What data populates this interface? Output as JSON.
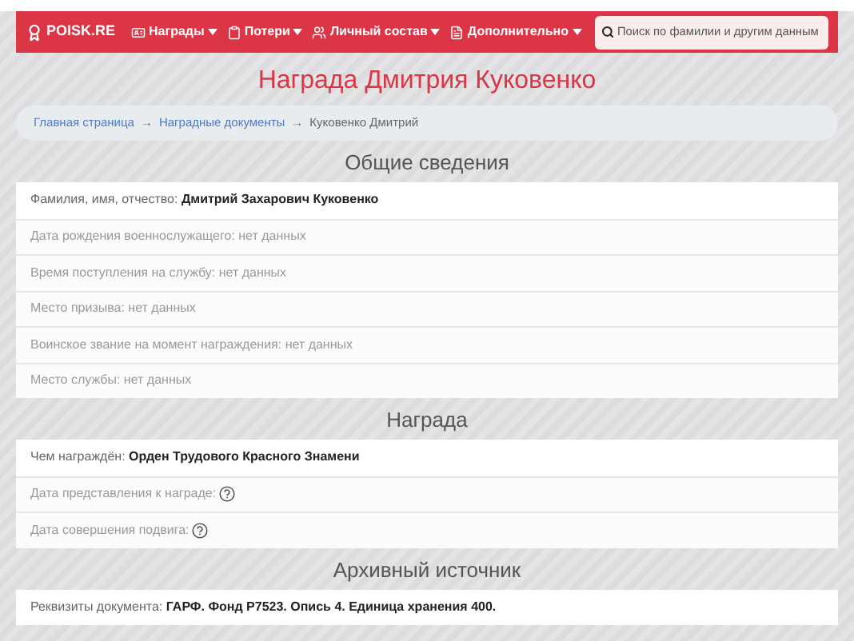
{
  "navbar": {
    "logo": "POISK.RE",
    "menus": [
      {
        "label": "Награды"
      },
      {
        "label": "Потери"
      },
      {
        "label": "Личный состав"
      },
      {
        "label": "Дополнительно"
      }
    ],
    "search": {
      "placeholder": "Поиск по фамилии и другим данным"
    }
  },
  "title": "Награда Дмитрия Куковенко",
  "breadcrumb": {
    "links": [
      "Главная страница",
      "Наградные документы"
    ],
    "separator": "→",
    "current": "Куковенко Дмитрий"
  },
  "sections": [
    {
      "heading": "Общие сведения",
      "rows": [
        {
          "kind": "value",
          "label": "Фамилия, имя, отчество:",
          "value": "Дмитрий Захарович Куковенко"
        },
        {
          "kind": "missing",
          "label": "Дата рождения военнослужащего: нет данных"
        },
        {
          "kind": "missing",
          "label": "Время поступления на службу: нет данных"
        },
        {
          "kind": "missing",
          "label": "Место призыва: нет данных"
        },
        {
          "kind": "missing",
          "label": "Воинское звание на момент награждения: нет данных"
        },
        {
          "kind": "missing",
          "label": "Место службы: нет данных"
        }
      ]
    },
    {
      "heading": "Награда",
      "rows": [
        {
          "kind": "value",
          "label": "Чем награждён:",
          "value": "Орден Трудового Красного Знамени"
        },
        {
          "kind": "help",
          "label": "Дата представления к награде:"
        },
        {
          "kind": "help",
          "label": "Дата совершения подвига:"
        }
      ]
    },
    {
      "heading": "Архивный источник",
      "rows": [
        {
          "kind": "value",
          "label": "Реквизиты документа:",
          "value": "ГАРФ. Фонд Р7523. Опись 4. Единица хранения 400."
        }
      ]
    }
  ]
}
